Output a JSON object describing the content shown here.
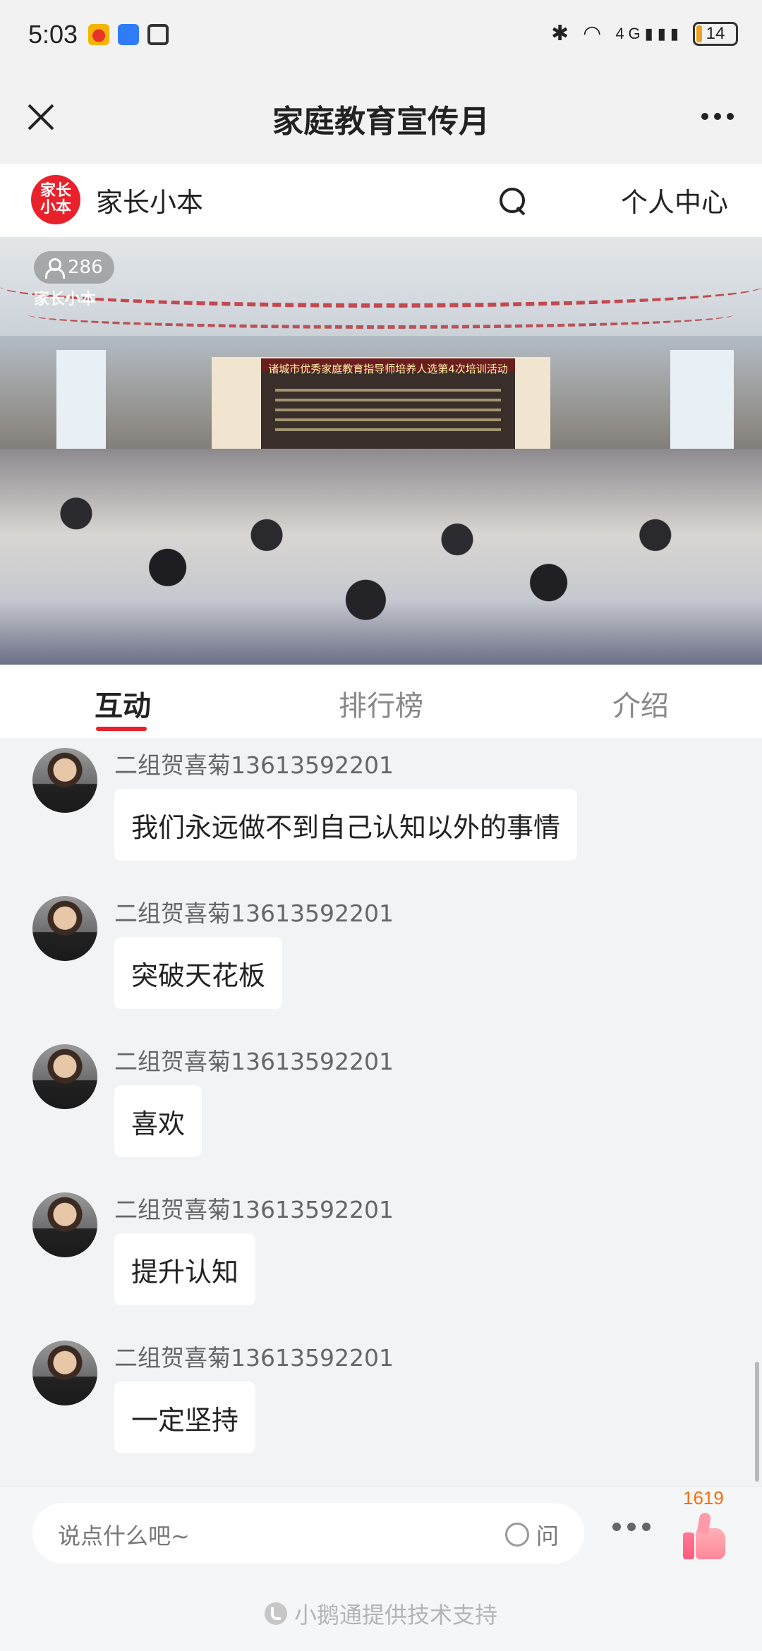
{
  "status_bar": {
    "time": "5:03",
    "battery": "14",
    "network": "4G"
  },
  "title_bar": {
    "title": "家庭教育宣传月"
  },
  "brand": {
    "logo_text": "家长小本",
    "name": "家长小本",
    "personal_center": "个人中心"
  },
  "video": {
    "viewer_count": "286",
    "watermark": "家长小本",
    "banner": "诸城市优秀家庭教育指导师培养人选第4次培训活动"
  },
  "tabs": [
    {
      "label": "互动",
      "active": true
    },
    {
      "label": "排行榜",
      "active": false
    },
    {
      "label": "介绍",
      "active": false
    }
  ],
  "messages": [
    {
      "name": "二组贺喜菊13613592201",
      "text": "我们永远做不到自己认知以外的事情"
    },
    {
      "name": "二组贺喜菊13613592201",
      "text": "突破天花板"
    },
    {
      "name": "二组贺喜菊13613592201",
      "text": "喜欢"
    },
    {
      "name": "二组贺喜菊13613592201",
      "text": "提升认知"
    },
    {
      "name": "二组贺喜菊13613592201",
      "text": "一定坚持"
    }
  ],
  "input": {
    "placeholder": "说点什么吧~",
    "ask_label": "问"
  },
  "like": {
    "count": "1619"
  },
  "footer": {
    "powered_by": "小鹅通提供技术支持"
  },
  "colors": {
    "accent": "#e8212a",
    "like_count": "#ff6a00"
  }
}
